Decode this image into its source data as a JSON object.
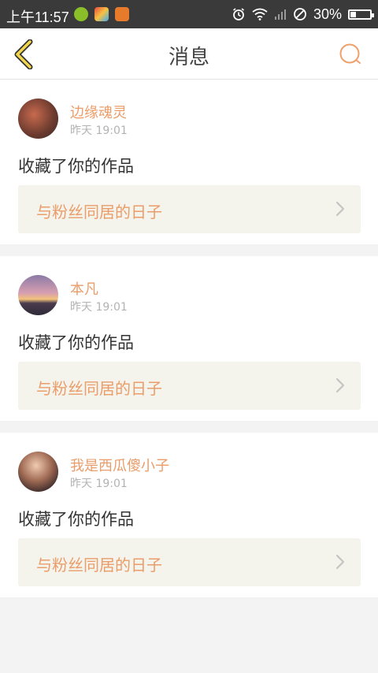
{
  "status_bar": {
    "time": "上午11:57",
    "battery": "30%",
    "battery_level": 0.3
  },
  "header": {
    "title": "消息",
    "back_icon": "chevron-left-icon",
    "search_icon": "search-icon",
    "accent_color": "#ea9d6a"
  },
  "messages": [
    {
      "user": "边缘魂灵",
      "time": "昨天 19:01",
      "action": "收藏了你的作品",
      "work_title": "与粉丝同居的日子"
    },
    {
      "user": "本凡",
      "time": "昨天 19:01",
      "action": "收藏了你的作品",
      "work_title": "与粉丝同居的日子"
    },
    {
      "user": "我是西瓜傻小子",
      "time": "昨天 19:01",
      "action": "收藏了你的作品",
      "work_title": "与粉丝同居的日子"
    }
  ]
}
